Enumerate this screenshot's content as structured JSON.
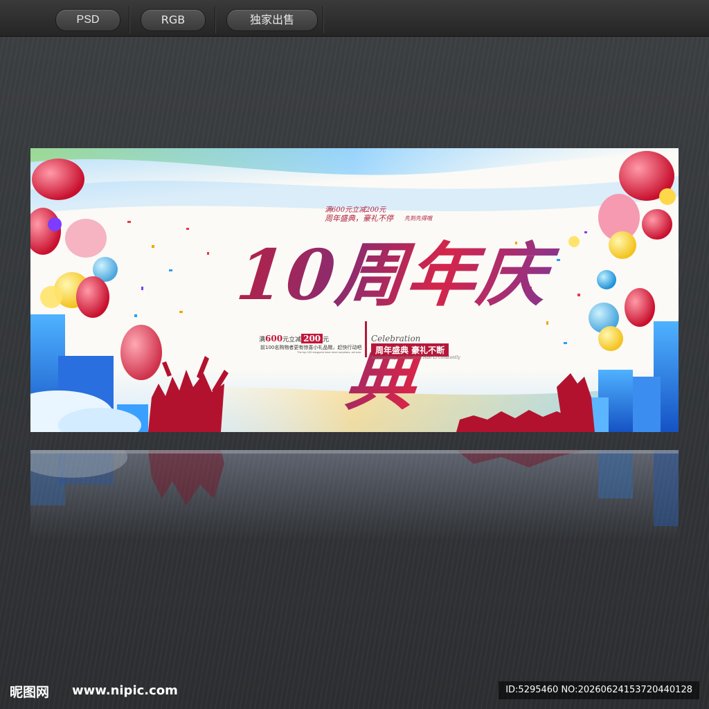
{
  "toolbar": {
    "badges": [
      "PSD",
      "RGB",
      "独家出售"
    ]
  },
  "banner": {
    "title": "10周年庆典",
    "slogan_top": "满600元立减200元",
    "slogan_hand": "周年盛典，豪礼不停",
    "slogan_hand2": "先到先得哦",
    "promo_prefix": "满",
    "promo_amount": "600",
    "promo_mid": "元立减",
    "promo_discount": "200",
    "promo_suffix": "元",
    "promo_sub": "前100名购物者更有惊喜小礼品赠，赶快行动吧",
    "promo_sub2": "The top 100 shoppers have more surprises, act now",
    "celebration": "Celebration",
    "celebration_tag": "周年盛典  豪礼不断",
    "celebration_sub": "Anniversary celebration  Hao Li constantly"
  },
  "footer": {
    "logo": "昵图网",
    "url": "www.nipic.com",
    "id_text": "ID:5295460 NO:20260624153720440128"
  }
}
